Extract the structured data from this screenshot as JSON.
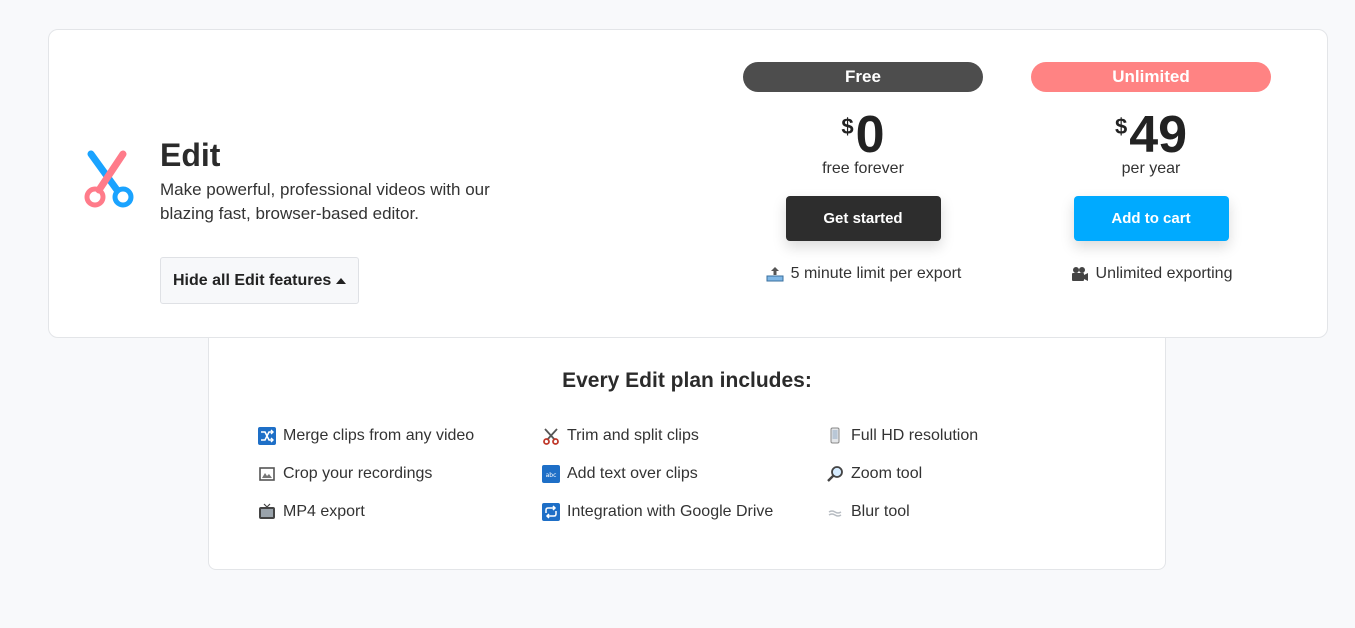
{
  "product": {
    "title": "Edit",
    "description": "Make powerful, professional videos with our blazing fast, browser-based editor.",
    "toggle_label": "Hide all Edit features",
    "logo_icon": "scissors-icon",
    "colors": {
      "logo_pink": "#ff7b8a",
      "logo_blue": "#1aa3ff"
    }
  },
  "plans": [
    {
      "name": "Free",
      "currency": "$",
      "price": "0",
      "period": "free forever",
      "button_label": "Get started",
      "note_icon": "upload-tray-icon",
      "note": "5 minute limit per export",
      "badge_color": "#4d4d4d",
      "button_color": "#2d2d2d"
    },
    {
      "name": "Unlimited",
      "currency": "$",
      "price": "49",
      "period": "per year",
      "button_label": "Add to cart",
      "note_icon": "movie-camera-icon",
      "note": "Unlimited exporting",
      "badge_color": "#ff8383",
      "button_color": "#00aaff"
    }
  ],
  "features": {
    "title": "Every Edit plan includes:",
    "items": [
      {
        "icon": "shuffle-icon",
        "label": "Merge clips from any video"
      },
      {
        "icon": "scissors-icon",
        "label": "Trim and split clips"
      },
      {
        "icon": "phone-icon",
        "label": "Full HD resolution"
      },
      {
        "icon": "framed-picture-icon",
        "label": "Crop your recordings"
      },
      {
        "icon": "abc-input-icon",
        "label": "Add text over clips"
      },
      {
        "icon": "magnifier-icon",
        "label": "Zoom tool"
      },
      {
        "icon": "television-icon",
        "label": "MP4 export"
      },
      {
        "icon": "repeat-icon",
        "label": "Integration with Google Drive"
      },
      {
        "icon": "fog-icon",
        "label": "Blur tool"
      }
    ]
  }
}
